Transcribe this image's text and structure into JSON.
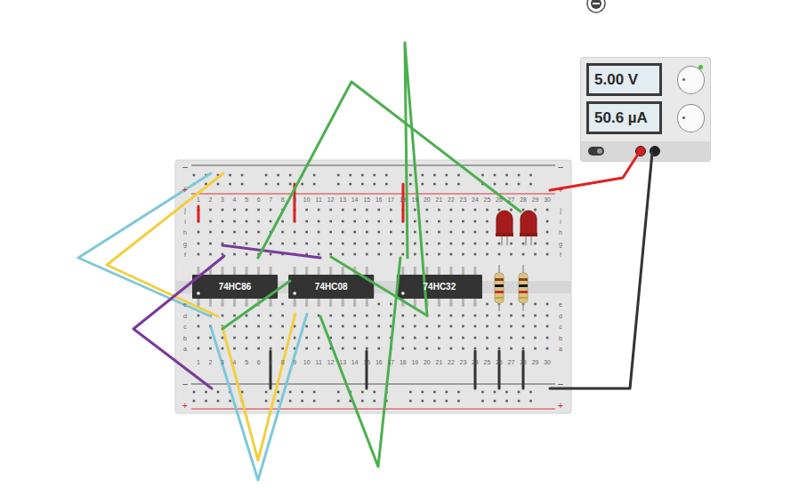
{
  "power_supply": {
    "voltage": "5.00 V",
    "current": "50.6 µA",
    "on": true
  },
  "breadboard": {
    "columns": [
      "1",
      "2",
      "3",
      "4",
      "5",
      "6",
      "7",
      "8",
      "9",
      "10",
      "11",
      "12",
      "13",
      "14",
      "15",
      "16",
      "17",
      "18",
      "19",
      "20",
      "21",
      "22",
      "23",
      "24",
      "25",
      "26",
      "27",
      "28",
      "29",
      "30"
    ],
    "rows_top": [
      "j",
      "i",
      "h",
      "g",
      "f"
    ],
    "rows_bottom": [
      "e",
      "d",
      "c",
      "b",
      "a"
    ],
    "rail_minus": "–",
    "rail_plus": "+"
  },
  "chips": [
    {
      "label": "74HC86"
    },
    {
      "label": "74HC08"
    },
    {
      "label": "74HC32"
    }
  ],
  "leds": [
    {
      "on": false
    },
    {
      "on": false
    }
  ],
  "wires": [
    {
      "color": "#e02020"
    },
    {
      "color": "#e02020"
    },
    {
      "color": "#e02020"
    },
    {
      "color": "#333333"
    },
    {
      "color": "#333333"
    },
    {
      "color": "#333333"
    },
    {
      "color": "#333333"
    },
    {
      "color": "#333333"
    },
    {
      "color": "#7ec8d8"
    },
    {
      "color": "#f2cf3f"
    },
    {
      "color": "#7ec8d8"
    },
    {
      "color": "#f2cf3f"
    },
    {
      "color": "#7a3a9a"
    },
    {
      "color": "#7a3a9a"
    },
    {
      "color": "#4caf50"
    },
    {
      "color": "#4caf50"
    },
    {
      "color": "#4caf50"
    },
    {
      "color": "#4caf50"
    },
    {
      "color": "#4caf50"
    },
    {
      "color": "#e02020"
    },
    {
      "color": "#333333"
    }
  ]
}
